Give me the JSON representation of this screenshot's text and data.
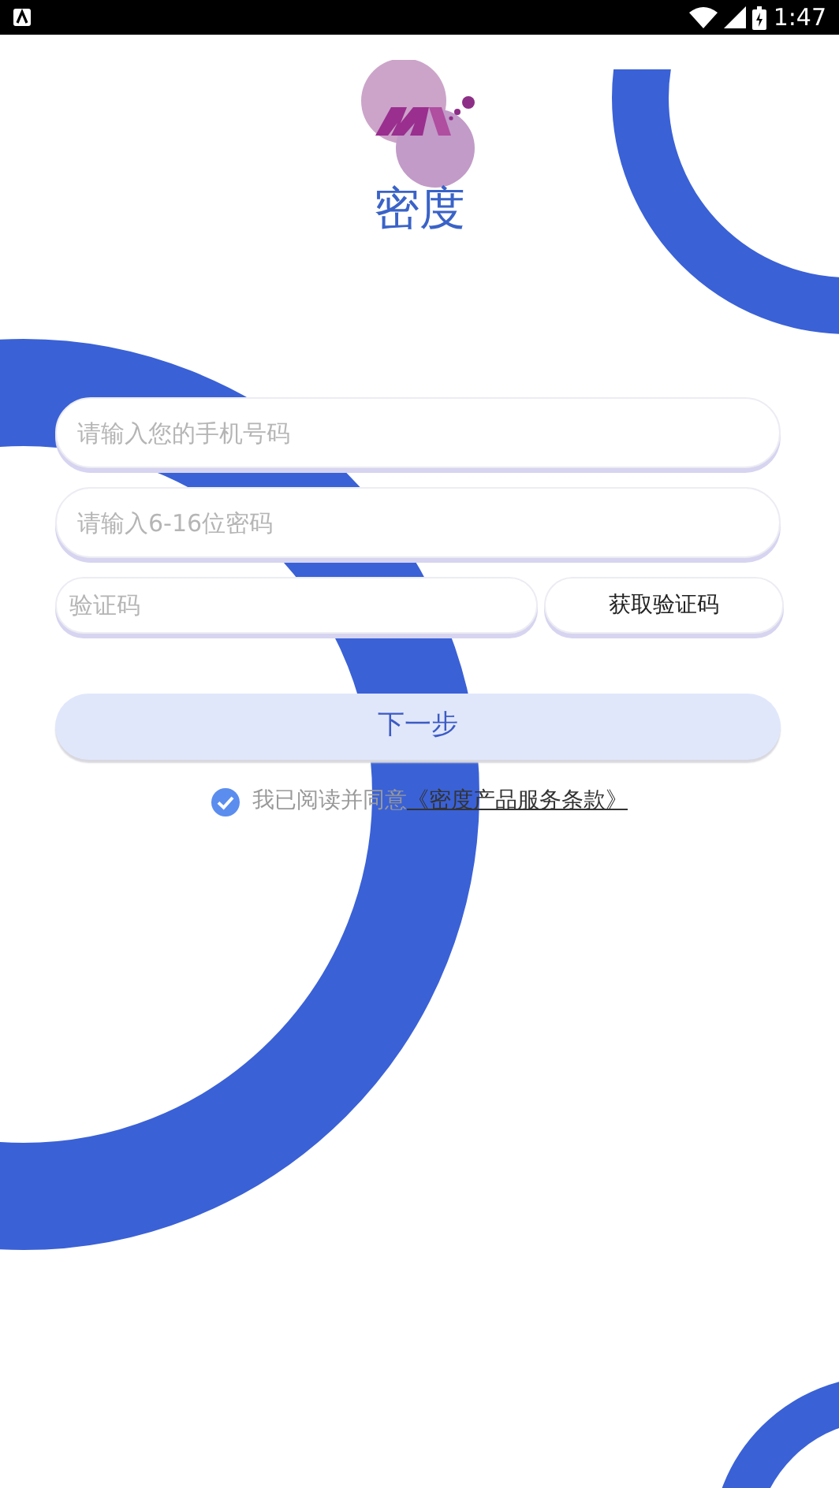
{
  "status_bar": {
    "time": "1:47"
  },
  "app": {
    "name": "密度"
  },
  "form": {
    "phone_field": {
      "placeholder": "请输入您的手机号码"
    },
    "password_field": {
      "placeholder": "请输入6-16位密码"
    },
    "code_field": {
      "placeholder": "验证码"
    },
    "get_code_button": {
      "label": "获取验证码"
    },
    "next_button": {
      "label": "下一步"
    },
    "agreement": {
      "checked": true,
      "text": "我已阅读并同意",
      "link": "《密度产品服务条款》"
    }
  }
}
